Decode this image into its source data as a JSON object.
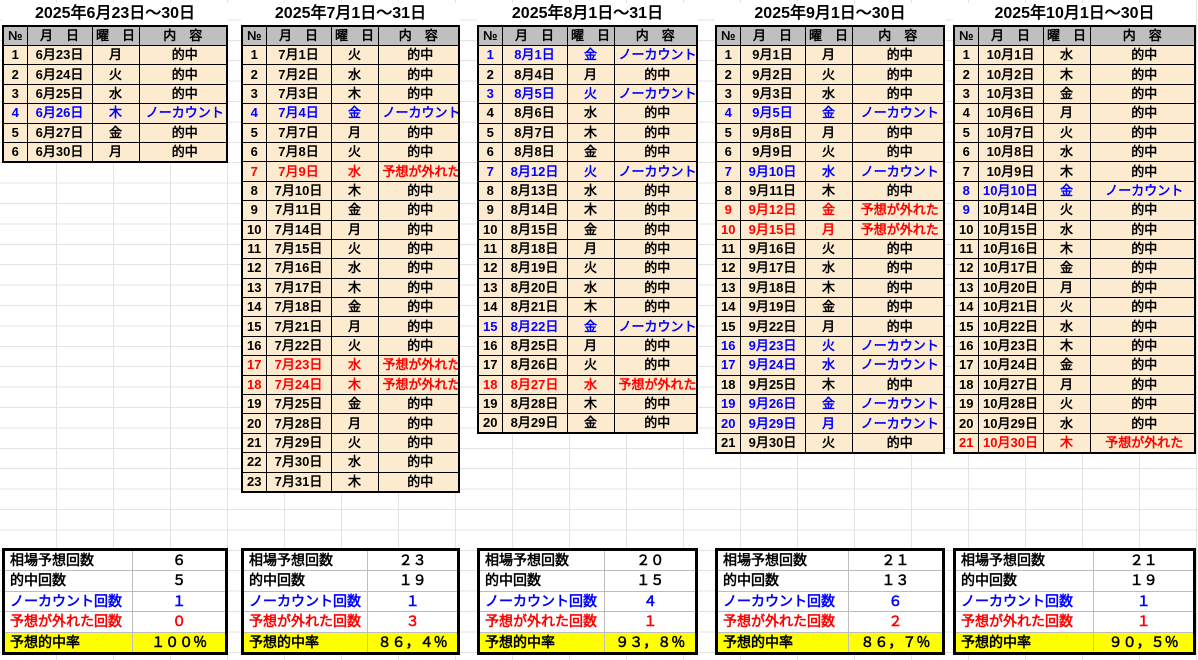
{
  "colors": {
    "hit_text": "#000000",
    "nocount_text": "#0000ff",
    "miss_text": "#ff0000",
    "row_bg": "#fdebd0",
    "header_bg": "#bfbfbf",
    "rate_row_bg": "#ffff00",
    "border": "#000000",
    "gridline": "#e3e3e3"
  },
  "table_headers": [
    "№",
    "月　日",
    "曜　日",
    "内　容"
  ],
  "summary_labels": [
    {
      "text": "相場予想回数",
      "type": "hit"
    },
    {
      "text": "的中回数",
      "type": "hit"
    },
    {
      "text": "ノーカウント回数",
      "type": "nocount"
    },
    {
      "text": "予想が外れた回数",
      "type": "miss"
    },
    {
      "text": "予想的中率",
      "type": "rate"
    }
  ],
  "months": [
    {
      "title": "2025年6月23日～30日",
      "rows": [
        {
          "no": "1",
          "date": "6月23日",
          "dow": "月",
          "result": "的中",
          "type": "hit"
        },
        {
          "no": "2",
          "date": "6月24日",
          "dow": "火",
          "result": "的中",
          "type": "hit"
        },
        {
          "no": "3",
          "date": "6月25日",
          "dow": "水",
          "result": "的中",
          "type": "hit"
        },
        {
          "no": "4",
          "date": "6月26日",
          "dow": "木",
          "result": "ノーカウント",
          "type": "nocount"
        },
        {
          "no": "5",
          "date": "6月27日",
          "dow": "金",
          "result": "的中",
          "type": "hit"
        },
        {
          "no": "6",
          "date": "6月30日",
          "dow": "月",
          "result": "的中",
          "type": "hit"
        }
      ],
      "summary_values": [
        "６",
        "５",
        "１",
        "０",
        "１００％"
      ]
    },
    {
      "title": "2025年7月1日～31日",
      "rows": [
        {
          "no": "1",
          "date": "7月1日",
          "dow": "火",
          "result": "的中",
          "type": "hit"
        },
        {
          "no": "2",
          "date": "7月2日",
          "dow": "水",
          "result": "的中",
          "type": "hit"
        },
        {
          "no": "3",
          "date": "7月3日",
          "dow": "木",
          "result": "的中",
          "type": "hit"
        },
        {
          "no": "4",
          "date": "7月4日",
          "dow": "金",
          "result": "ノーカウント",
          "type": "nocount"
        },
        {
          "no": "5",
          "date": "7月7日",
          "dow": "月",
          "result": "的中",
          "type": "hit"
        },
        {
          "no": "6",
          "date": "7月8日",
          "dow": "火",
          "result": "的中",
          "type": "hit"
        },
        {
          "no": "7",
          "date": "7月9日",
          "dow": "水",
          "result": "予想が外れた",
          "type": "miss"
        },
        {
          "no": "8",
          "date": "7月10日",
          "dow": "木",
          "result": "的中",
          "type": "hit"
        },
        {
          "no": "9",
          "date": "7月11日",
          "dow": "金",
          "result": "的中",
          "type": "hit"
        },
        {
          "no": "10",
          "date": "7月14日",
          "dow": "月",
          "result": "的中",
          "type": "hit"
        },
        {
          "no": "11",
          "date": "7月15日",
          "dow": "火",
          "result": "的中",
          "type": "hit"
        },
        {
          "no": "12",
          "date": "7月16日",
          "dow": "水",
          "result": "的中",
          "type": "hit"
        },
        {
          "no": "13",
          "date": "7月17日",
          "dow": "木",
          "result": "的中",
          "type": "hit"
        },
        {
          "no": "14",
          "date": "7月18日",
          "dow": "金",
          "result": "的中",
          "type": "hit"
        },
        {
          "no": "15",
          "date": "7月21日",
          "dow": "月",
          "result": "的中",
          "type": "hit"
        },
        {
          "no": "16",
          "date": "7月22日",
          "dow": "火",
          "result": "的中",
          "type": "hit"
        },
        {
          "no": "17",
          "date": "7月23日",
          "dow": "水",
          "result": "予想が外れた",
          "type": "miss"
        },
        {
          "no": "18",
          "date": "7月24日",
          "dow": "木",
          "result": "予想が外れた",
          "type": "miss"
        },
        {
          "no": "19",
          "date": "7月25日",
          "dow": "金",
          "result": "的中",
          "type": "hit"
        },
        {
          "no": "20",
          "date": "7月28日",
          "dow": "月",
          "result": "的中",
          "type": "hit"
        },
        {
          "no": "21",
          "date": "7月29日",
          "dow": "火",
          "result": "的中",
          "type": "hit"
        },
        {
          "no": "22",
          "date": "7月30日",
          "dow": "水",
          "result": "的中",
          "type": "hit"
        },
        {
          "no": "23",
          "date": "7月31日",
          "dow": "木",
          "result": "的中",
          "type": "hit"
        }
      ],
      "summary_values": [
        "２３",
        "１９",
        "１",
        "３",
        "８６，４％"
      ]
    },
    {
      "title": "2025年8月1日～31日",
      "rows": [
        {
          "no": "1",
          "date": "8月1日",
          "dow": "金",
          "result": "ノーカウント",
          "type": "nocount"
        },
        {
          "no": "2",
          "date": "8月4日",
          "dow": "月",
          "result": "的中",
          "type": "hit"
        },
        {
          "no": "3",
          "date": "8月5日",
          "dow": "火",
          "result": "ノーカウント",
          "type": "nocount"
        },
        {
          "no": "4",
          "date": "8月6日",
          "dow": "水",
          "result": "的中",
          "type": "hit"
        },
        {
          "no": "5",
          "date": "8月7日",
          "dow": "木",
          "result": "的中",
          "type": "hit"
        },
        {
          "no": "6",
          "date": "8月8日",
          "dow": "金",
          "result": "的中",
          "type": "hit"
        },
        {
          "no": "7",
          "date": "8月12日",
          "dow": "火",
          "result": "ノーカウント",
          "type": "nocount"
        },
        {
          "no": "8",
          "date": "8月13日",
          "dow": "水",
          "result": "的中",
          "type": "hit"
        },
        {
          "no": "9",
          "date": "8月14日",
          "dow": "木",
          "result": "的中",
          "type": "hit"
        },
        {
          "no": "10",
          "date": "8月15日",
          "dow": "金",
          "result": "的中",
          "type": "hit"
        },
        {
          "no": "11",
          "date": "8月18日",
          "dow": "月",
          "result": "的中",
          "type": "hit"
        },
        {
          "no": "12",
          "date": "8月19日",
          "dow": "火",
          "result": "的中",
          "type": "hit"
        },
        {
          "no": "13",
          "date": "8月20日",
          "dow": "水",
          "result": "的中",
          "type": "hit"
        },
        {
          "no": "14",
          "date": "8月21日",
          "dow": "木",
          "result": "的中",
          "type": "hit"
        },
        {
          "no": "15",
          "date": "8月22日",
          "dow": "金",
          "result": "ノーカウント",
          "type": "nocount"
        },
        {
          "no": "16",
          "date": "8月25日",
          "dow": "月",
          "result": "的中",
          "type": "hit"
        },
        {
          "no": "17",
          "date": "8月26日",
          "dow": "火",
          "result": "的中",
          "type": "hit"
        },
        {
          "no": "18",
          "date": "8月27日",
          "dow": "水",
          "result": "予想が外れた",
          "type": "miss"
        },
        {
          "no": "19",
          "date": "8月28日",
          "dow": "木",
          "result": "的中",
          "type": "hit"
        },
        {
          "no": "20",
          "date": "8月29日",
          "dow": "金",
          "result": "的中",
          "type": "hit"
        }
      ],
      "summary_values": [
        "２０",
        "１５",
        "４",
        "１",
        "９３，８％"
      ]
    },
    {
      "title": "2025年9月1日～30日",
      "rows": [
        {
          "no": "1",
          "date": "9月1日",
          "dow": "月",
          "result": "的中",
          "type": "hit"
        },
        {
          "no": "2",
          "date": "9月2日",
          "dow": "火",
          "result": "的中",
          "type": "hit"
        },
        {
          "no": "3",
          "date": "9月3日",
          "dow": "水",
          "result": "的中",
          "type": "hit"
        },
        {
          "no": "4",
          "date": "9月5日",
          "dow": "金",
          "result": "ノーカウント",
          "type": "nocount"
        },
        {
          "no": "5",
          "date": "9月8日",
          "dow": "月",
          "result": "的中",
          "type": "hit"
        },
        {
          "no": "6",
          "date": "9月9日",
          "dow": "火",
          "result": "的中",
          "type": "hit"
        },
        {
          "no": "7",
          "date": "9月10日",
          "dow": "水",
          "result": "ノーカウント",
          "type": "nocount"
        },
        {
          "no": "8",
          "date": "9月11日",
          "dow": "木",
          "result": "的中",
          "type": "hit"
        },
        {
          "no": "9",
          "date": "9月12日",
          "dow": "金",
          "result": "予想が外れた",
          "type": "miss"
        },
        {
          "no": "10",
          "date": "9月15日",
          "dow": "月",
          "result": "予想が外れた",
          "type": "miss"
        },
        {
          "no": "11",
          "date": "9月16日",
          "dow": "火",
          "result": "的中",
          "type": "hit"
        },
        {
          "no": "12",
          "date": "9月17日",
          "dow": "水",
          "result": "的中",
          "type": "hit"
        },
        {
          "no": "13",
          "date": "9月18日",
          "dow": "木",
          "result": "的中",
          "type": "hit"
        },
        {
          "no": "14",
          "date": "9月19日",
          "dow": "金",
          "result": "的中",
          "type": "hit"
        },
        {
          "no": "15",
          "date": "9月22日",
          "dow": "月",
          "result": "的中",
          "type": "hit"
        },
        {
          "no": "16",
          "date": "9月23日",
          "dow": "火",
          "result": "ノーカウント",
          "type": "nocount"
        },
        {
          "no": "17",
          "date": "9月24日",
          "dow": "水",
          "result": "ノーカウント",
          "type": "nocount"
        },
        {
          "no": "18",
          "date": "9月25日",
          "dow": "木",
          "result": "的中",
          "type": "hit"
        },
        {
          "no": "19",
          "date": "9月26日",
          "dow": "金",
          "result": "ノーカウント",
          "type": "nocount"
        },
        {
          "no": "20",
          "date": "9月29日",
          "dow": "月",
          "result": "ノーカウント",
          "type": "nocount"
        },
        {
          "no": "21",
          "date": "9月30日",
          "dow": "火",
          "result": "的中",
          "type": "hit"
        }
      ],
      "summary_values": [
        "２１",
        "１３",
        "６",
        "２",
        "８６，７％"
      ]
    },
    {
      "title": "2025年10月1日～30日",
      "rows": [
        {
          "no": "1",
          "date": "10月1日",
          "dow": "水",
          "result": "的中",
          "type": "hit"
        },
        {
          "no": "2",
          "date": "10月2日",
          "dow": "木",
          "result": "的中",
          "type": "hit"
        },
        {
          "no": "3",
          "date": "10月3日",
          "dow": "金",
          "result": "的中",
          "type": "hit"
        },
        {
          "no": "4",
          "date": "10月6日",
          "dow": "月",
          "result": "的中",
          "type": "hit"
        },
        {
          "no": "5",
          "date": "10月7日",
          "dow": "火",
          "result": "的中",
          "type": "hit"
        },
        {
          "no": "6",
          "date": "10月8日",
          "dow": "水",
          "result": "的中",
          "type": "hit"
        },
        {
          "no": "7",
          "date": "10月9日",
          "dow": "木",
          "result": "的中",
          "type": "hit"
        },
        {
          "no": "8",
          "date": "10月10日",
          "dow": "金",
          "result": "ノーカウント",
          "type": "nocount"
        },
        {
          "no": "9",
          "date": "10月14日",
          "dow": "火",
          "result": "的中",
          "type": "hit",
          "no_type": "nocount"
        },
        {
          "no": "10",
          "date": "10月15日",
          "dow": "水",
          "result": "的中",
          "type": "hit"
        },
        {
          "no": "11",
          "date": "10月16日",
          "dow": "木",
          "result": "的中",
          "type": "hit"
        },
        {
          "no": "12",
          "date": "10月17日",
          "dow": "金",
          "result": "的中",
          "type": "hit"
        },
        {
          "no": "13",
          "date": "10月20日",
          "dow": "月",
          "result": "的中",
          "type": "hit"
        },
        {
          "no": "14",
          "date": "10月21日",
          "dow": "火",
          "result": "的中",
          "type": "hit"
        },
        {
          "no": "15",
          "date": "10月22日",
          "dow": "水",
          "result": "的中",
          "type": "hit"
        },
        {
          "no": "16",
          "date": "10月23日",
          "dow": "木",
          "result": "的中",
          "type": "hit"
        },
        {
          "no": "17",
          "date": "10月24日",
          "dow": "金",
          "result": "的中",
          "type": "hit"
        },
        {
          "no": "18",
          "date": "10月27日",
          "dow": "月",
          "result": "的中",
          "type": "hit"
        },
        {
          "no": "19",
          "date": "10月28日",
          "dow": "火",
          "result": "的中",
          "type": "hit"
        },
        {
          "no": "20",
          "date": "10月29日",
          "dow": "水",
          "result": "的中",
          "type": "hit"
        },
        {
          "no": "21",
          "date": "10月30日",
          "dow": "木",
          "result": "予想が外れた",
          "type": "miss"
        }
      ],
      "summary_values": [
        "２１",
        "１９",
        "１",
        "１",
        "９０，５％"
      ]
    }
  ]
}
